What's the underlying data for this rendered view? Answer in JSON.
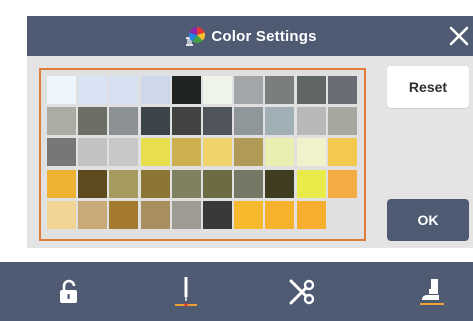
{
  "dialog": {
    "title": "Color Settings",
    "title_icon": "color-spool-icon",
    "close_icon": "close-icon",
    "reset_label": "Reset",
    "ok_label": "OK"
  },
  "palette": {
    "border_color": "#e07b39",
    "colors": [
      "#eef5fc",
      "#d8e4f3",
      "#d6e2f2",
      "#cdd9ea",
      "#1f2322",
      "#eef5e8",
      "#a3a6a9",
      "#7a7e7d",
      "#5f6663",
      "#6a6d75",
      "#a9ada4",
      "#6b6f64",
      "#8c9193",
      "#3a4449",
      "#414242",
      "#50545b",
      "#8f979a",
      "#a1b0b7",
      "#b8b8b8",
      "#a6a8a0",
      "#777777",
      "#c2c2c2",
      "#c7c7c7",
      "#e8df4e",
      "#cfb050",
      "#f0d36a",
      "#b09a56",
      "#eaeeb0",
      "#f1f1cc",
      "#f2c94c",
      "#f0b232",
      "#5e4c20",
      "#a59b5e",
      "#8d7635",
      "#7f805f",
      "#6c6b41",
      "#767665",
      "#403c20",
      "#e8eb49",
      "#f4ad44",
      "#f2d595",
      "#c8aa79",
      "#a47a2e",
      "#a98f60",
      "#9d9b94",
      "#3a3838",
      "#f7b92d",
      "#f7b22d",
      "#f6ae2e"
    ]
  },
  "toolbar": {
    "items": [
      {
        "name": "unlock-icon"
      },
      {
        "name": "needle-icon"
      },
      {
        "name": "thread-cutter-icon"
      },
      {
        "name": "presser-foot-icon"
      }
    ],
    "bar_color": "#4e5b72"
  }
}
